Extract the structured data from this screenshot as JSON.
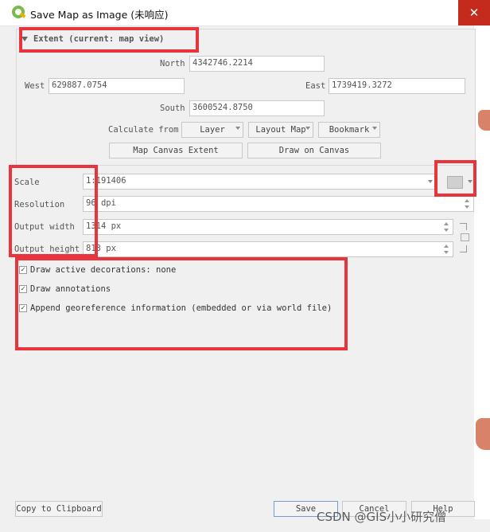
{
  "window": {
    "title": "Save Map as Image (未响应)",
    "close_glyph": "✕"
  },
  "extent": {
    "header": "Extent (current: map view)",
    "north_label": "North",
    "north_value": "4342746.2214",
    "west_label": "West",
    "west_value": "629887.0754",
    "east_label": "East",
    "east_value": "1739419.3272",
    "south_label": "South",
    "south_value": "3600524.8750",
    "calculate_from": "Calculate from",
    "layer_btn": "Layer",
    "layout_map_btn": "Layout Map",
    "bookmark_btn": "Bookmark",
    "map_canvas_extent_btn": "Map Canvas Extent",
    "draw_on_canvas_btn": "Draw on Canvas"
  },
  "settings": {
    "scale_label": "Scale",
    "scale_value": "1:191406",
    "resolution_label": "Resolution",
    "resolution_value": "96 dpi",
    "output_width_label": "Output width",
    "output_width_value": "1314 px",
    "output_height_label": "Output height",
    "output_height_value": "813 px"
  },
  "options": {
    "draw_decorations": "Draw active decorations: none",
    "draw_annotations": "Draw annotations",
    "append_georef": "Append georeference information (embedded or via world file)"
  },
  "footer": {
    "copy_clipboard": "Copy to Clipboard",
    "save": "Save",
    "cancel": "Cancel",
    "help": "Help"
  },
  "watermark": "CSDN @GIS小小研究僧",
  "colors": {
    "highlight": "#e8343d",
    "close": "#c42b1c"
  }
}
